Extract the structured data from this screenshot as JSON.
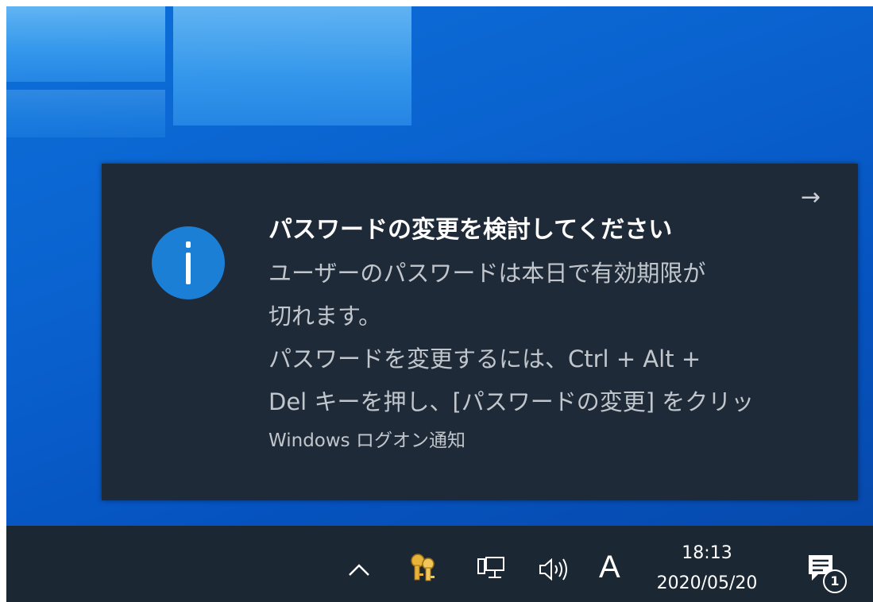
{
  "notification": {
    "title": "パスワードの変更を検討してください",
    "body_lines": [
      "ユーザーのパスワードは本日で有効期限が",
      "切れます。",
      "パスワードを変更するには、Ctrl + Alt +",
      "Del キーを押し、[パスワードの変更] をクリッ"
    ],
    "source": "Windows ログオン通知",
    "icon": "info-icon",
    "expand_icon": "→",
    "accent_color": "#1b7fd6",
    "background_color": "#1f2a38"
  },
  "taskbar": {
    "tray_icons": [
      "chevron-up-icon",
      "key-icon",
      "network-icon",
      "volume-icon"
    ],
    "ime_label": "A",
    "clock": {
      "time": "18:13",
      "date": "2020/05/20"
    },
    "action_center": {
      "icon": "notification-icon",
      "badge_count": "1"
    },
    "background_color": "#1c2734"
  },
  "desktop": {
    "wallpaper": "windows-10-blue"
  }
}
